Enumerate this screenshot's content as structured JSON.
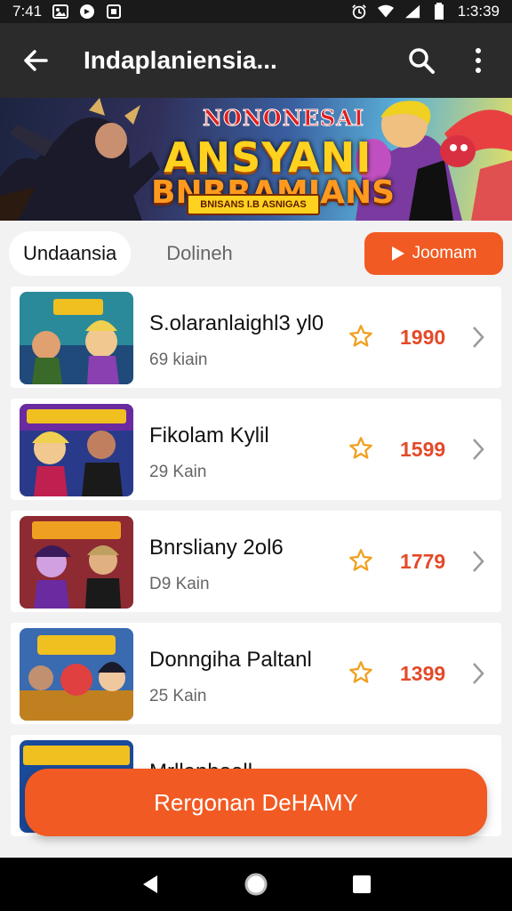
{
  "status_bar": {
    "time": "7:41",
    "clock_right": "1:3:39",
    "left_icons": [
      "image-icon",
      "app-icon",
      "notification-icon"
    ],
    "right_icons": [
      "alarm-icon",
      "wifi-icon",
      "signal-icon",
      "battery-icon"
    ]
  },
  "app_bar": {
    "title": "Indaplaniensia...",
    "back_icon": "arrow-left-icon",
    "actions": [
      "search-icon",
      "more-vert-icon"
    ]
  },
  "banner": {
    "kicker": "NONONESAI",
    "title_line1": "ANSYANI",
    "title_line2": "BNRRAMIANS",
    "subline": "BNISANS I.B ASNIGAS"
  },
  "tabs": {
    "active": "Undaansia",
    "inactive": "Dolineh",
    "join_label": "Joomam",
    "join_icon": "play-icon"
  },
  "items": [
    {
      "title": "S.olaranlaighl3 yl0",
      "sub": "69 kiain",
      "score": "1990",
      "thumb_caption": "VANAN"
    },
    {
      "title": "Fikolam Kylil",
      "sub": "29 Kain",
      "score": "1599",
      "thumb_caption": "NAIOIOANS RUU"
    },
    {
      "title": "Bnrsliany 2ol6",
      "sub": "D9 Kain",
      "score": "1779",
      "thumb_caption": "RAUNBAN ROUNN"
    },
    {
      "title": "Donngiha Paltanl",
      "sub": "25 Kain",
      "score": "1399",
      "thumb_caption": "WIANOON"
    },
    {
      "title": "Mrllanhoell",
      "sub": "",
      "score": "",
      "thumb_caption": "NONGNANES"
    }
  ],
  "cta": {
    "label": "Rergonan DeHAMY"
  },
  "colors": {
    "accent": "#f15a22",
    "score": "#e34a2a",
    "star": "#f0a020"
  }
}
